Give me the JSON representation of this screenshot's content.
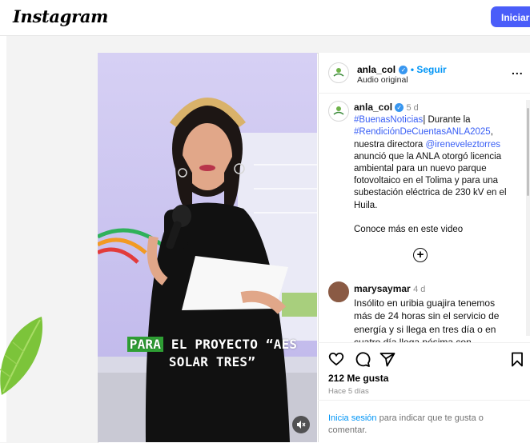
{
  "app": {
    "logo": "Instagram",
    "login_button": "Iniciar s"
  },
  "video": {
    "caption_highlight": "PARA",
    "caption_line1_rest": " EL PROYECTO “AES",
    "caption_line2": "SOLAR TRES”",
    "mute_icon": "muted-speaker-icon"
  },
  "post_header": {
    "username": "anla_col",
    "separator": " • ",
    "follow": "Seguir",
    "audio": "Audio original",
    "more": "..."
  },
  "caption_comment": {
    "username": "anla_col",
    "time": "5 d",
    "hashtag1": "#BuenasNoticias",
    "text1": "| Durante la",
    "hashtag2": "#RendiciónDeCuentasANLA2025",
    "text2": ",",
    "text3": "nuestra directora ",
    "mention": "@ireneveleztorres",
    "text4": "anunció que la ANLA otorgó licencia ambiental para un nuevo parque fotovoltaico en el Tolima y para una subestación eléctrica de 230 kV en el Huila.",
    "text5": "Conoce más en este video"
  },
  "load_more_icon": "plus-circle-icon",
  "comment": {
    "username": "marysaymar",
    "time": "4 d",
    "text": "Insólito en uribia guajira tenemos más de 24 horas sin el servicio de energía y si llega en tres día o en cuatro día llega pésima con"
  },
  "actions": {
    "like_icon": "heart-icon",
    "comment_icon": "comment-icon",
    "share_icon": "share-icon",
    "save_icon": "bookmark-icon",
    "likes": "212 Me gusta",
    "ago": "Hace 5 días"
  },
  "login_prompt": {
    "link": "Inicia sesión",
    "rest": " para indicar que te gusta o comentar."
  },
  "colors": {
    "accent": "#0095f6",
    "button": "#4a5df9",
    "hashtag": "#385ef5",
    "caption_highlight": "#2e9f34"
  }
}
